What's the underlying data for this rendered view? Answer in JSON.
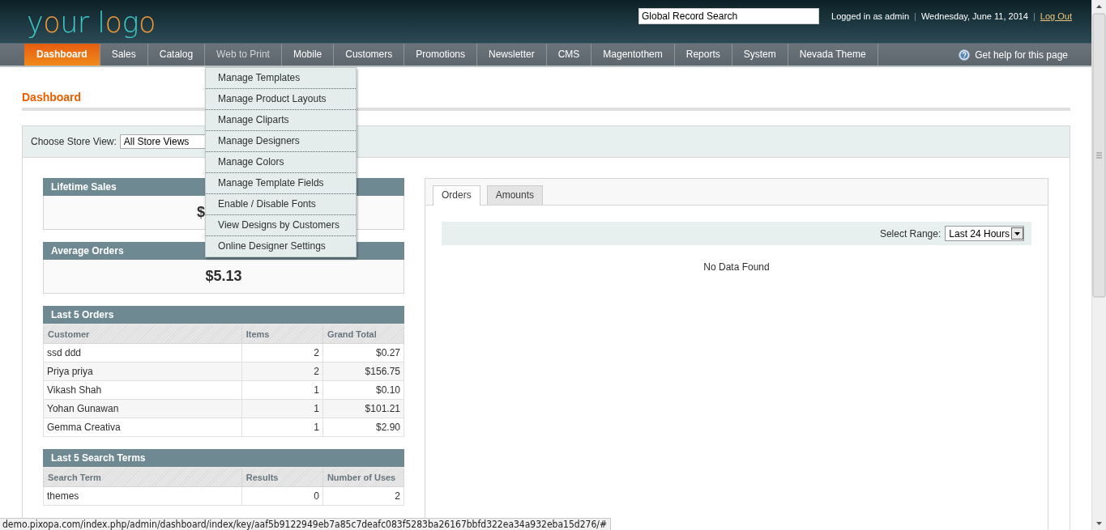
{
  "header": {
    "logo": "your logo",
    "search": {
      "value": "Global Record Search"
    },
    "user_text": "Logged in as admin",
    "separator_1": "|",
    "date": "Wednesday, June 11, 2014",
    "separator_2": "|",
    "logout": "Log Out"
  },
  "nav": {
    "items": [
      {
        "label": "Dashboard",
        "selected": true,
        "expanded": false
      },
      {
        "label": "Sales",
        "selected": false,
        "expanded": false
      },
      {
        "label": "Catalog",
        "selected": false,
        "expanded": false
      },
      {
        "label": "Web to Print",
        "selected": false,
        "expanded": true,
        "children": [
          "Manage Templates",
          "Manage Product Layouts",
          "Manage Cliparts",
          "Manage Designers",
          "Manage Colors",
          "Manage Template Fields",
          "Enable / Disable Fonts",
          "View Designs by Customers",
          "Online Designer Settings"
        ]
      },
      {
        "label": "Mobile",
        "selected": false,
        "expanded": false
      },
      {
        "label": "Customers",
        "selected": false,
        "expanded": false
      },
      {
        "label": "Promotions",
        "selected": false,
        "expanded": false
      },
      {
        "label": "Newsletter",
        "selected": false,
        "expanded": false
      },
      {
        "label": "CMS",
        "selected": false,
        "expanded": false
      },
      {
        "label": "Magentothem",
        "selected": false,
        "expanded": false
      },
      {
        "label": "Reports",
        "selected": false,
        "expanded": false
      },
      {
        "label": "System",
        "selected": false,
        "expanded": false
      },
      {
        "label": "Nevada Theme",
        "selected": false,
        "expanded": false
      }
    ],
    "help": "Get help for this page"
  },
  "page_title": "Dashboard",
  "store_switcher": {
    "label": "Choose Store View:",
    "value": "All Store Views"
  },
  "boxes": [
    {
      "title": "Lifetime Sales",
      "value": "$"
    },
    {
      "title": "Average Orders",
      "value": "$5.13"
    }
  ],
  "tables": [
    {
      "title": "Last 5 Orders",
      "columns": [
        "Customer",
        "Items",
        "Grand Total"
      ],
      "rows": [
        [
          "ssd ddd",
          "2",
          "$0.27"
        ],
        [
          "Priya priya",
          "2",
          "$156.75"
        ],
        [
          "Vikash Shah",
          "1",
          "$0.10"
        ],
        [
          "Yohan Gunawan",
          "1",
          "$101.21"
        ],
        [
          "Gemma Creativa",
          "1",
          "$2.90"
        ]
      ]
    },
    {
      "title": "Last 5 Search Terms",
      "columns": [
        "Search Term",
        "Results",
        "Number of Uses"
      ],
      "rows": [
        [
          "themes",
          "0",
          "2"
        ]
      ]
    }
  ],
  "chart_panel": {
    "tabs": [
      {
        "label": "Orders",
        "selected": true
      },
      {
        "label": "Amounts",
        "selected": false
      }
    ],
    "range_label": "Select Range:",
    "range_value": "Last 24 Hours",
    "message": "No Data Found"
  },
  "status_bar": {
    "url": "demo.pixopa.com/index.php/admin/dashboard/index/key/aaf5b9122949eb7a85c7deafc083f5283ba26167bbfd322ea34a932eba15d276/#"
  }
}
